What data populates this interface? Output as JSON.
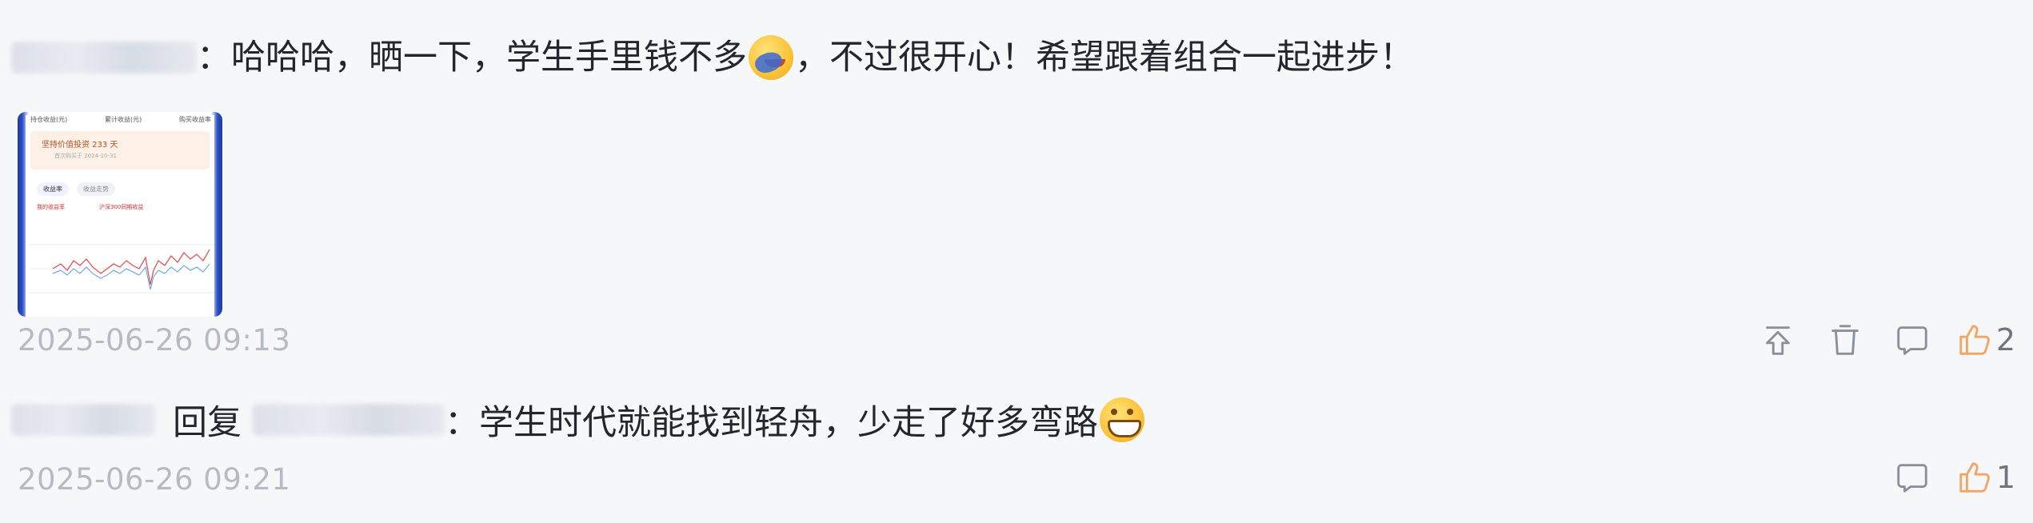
{
  "comments": [
    {
      "reply_prefix": "",
      "text_part1": "：哈哈哈，晒一下，学生手里钱不多",
      "emoji": "facepalm-emoji",
      "text_part2": "，不过很开心！希望跟着组合一起进步！",
      "has_image": true,
      "timestamp": "2025-06-26 09:13",
      "likes": "2"
    },
    {
      "reply_word": "回复",
      "text_part1": "：学生时代就能找到轻舟，少走了好多弯路",
      "emoji": "grinning-emoji",
      "timestamp": "2025-06-26 09:21",
      "likes": "1"
    }
  ],
  "thumbnail": {
    "top_left": "持仓收益(元)",
    "top_mid": "累计收益(元)",
    "top_right": "购买收益率",
    "banner_title": "坚持价值投资 233 天",
    "banner_sub": "首次购买于 2024-10-31",
    "tab_active": "收益率",
    "tab_other": "收益走势",
    "stat1": "我的收益率",
    "stat2": "沪深300同期收益"
  },
  "colors": {
    "background": "#f6f7f9",
    "text": "#23262d",
    "timestamp": "#b6bac3",
    "icon_gray": "#8a8f99",
    "like_orange": "#f3a564"
  },
  "icons": {
    "pin": "pin-top-icon",
    "delete": "trash-icon",
    "comment": "comment-bubble-icon",
    "like": "thumbs-up-icon"
  }
}
